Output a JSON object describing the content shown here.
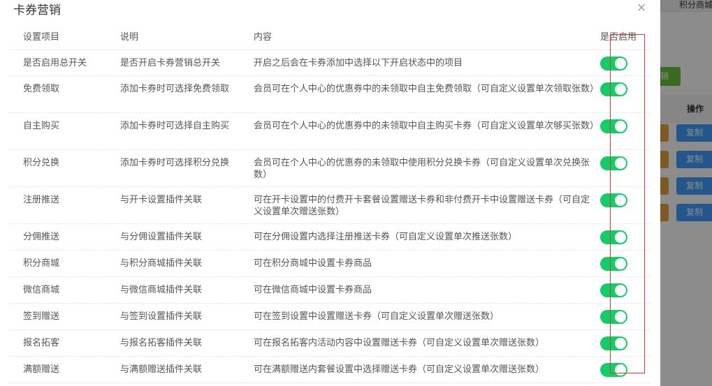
{
  "background": {
    "tab_label": "积分商城",
    "green_button_label": "销",
    "operations_header": "操作",
    "copy_label": "复制"
  },
  "dialog": {
    "title": "卡券营销",
    "close_icon": "close-icon"
  },
  "table": {
    "headers": [
      "设置项目",
      "说明",
      "内容",
      "是否启用"
    ],
    "rows": [
      {
        "item": "是否启用总开关",
        "desc": "是否开启卡券营销总开关",
        "content": "开启之后会在卡券添加中选择以下开启状态中的项目",
        "enabled": true
      },
      {
        "item": "免费领取",
        "desc": "添加卡券时可选择免费领取",
        "content": "会员可在个人中心的优惠券中的未领取中自主免费领取（可自定义设置单次领取张数）",
        "enabled": true
      },
      {
        "item": "自主购买",
        "desc": "添加卡券时可选择自主购买",
        "content": "会员可在个人中心的优惠券中的未领取中自主购买卡券（可自定义设置单次够买张数）",
        "enabled": true
      },
      {
        "item": "积分兑换",
        "desc": "添加卡券时可选择积分兑换",
        "content": "会员可在个人中心的优惠券的未领取中使用积分兑换卡券（可自定义设置单次兑换张数）",
        "enabled": true
      },
      {
        "item": "注册推送",
        "desc": "与开卡设置插件关联",
        "content": "可在开卡设置中的付费开卡套餐设置赠送卡券和非付费开卡中设置赠送卡券（可自定义设置单次赠送张数）",
        "enabled": true
      },
      {
        "item": "分佣推送",
        "desc": "与分佣设置插件关联",
        "content": "可在分佣设置内选择注册推送卡券（可自定义设置单次推送张数）",
        "enabled": true
      },
      {
        "item": "积分商城",
        "desc": "与积分商城插件关联",
        "content": "可在积分商城中设置卡券商品",
        "enabled": true
      },
      {
        "item": "微信商城",
        "desc": "与微信商城插件关联",
        "content": "可在微信商城中设置卡券商品",
        "enabled": true
      },
      {
        "item": "签到赠送",
        "desc": "与签到设置插件关联",
        "content": "可在签到设置中设置赠送卡券（可自定义设置单次赠送张数）",
        "enabled": true
      },
      {
        "item": "报名拓客",
        "desc": "与报名拓客插件关联",
        "content": "可在报名拓客内活动内容中设置赠送卡券（可自定义设置单次赠送张数）",
        "enabled": true
      },
      {
        "item": "满额赠送",
        "desc": "与满额赠送插件关联",
        "content": "可在满额赠送内套餐设置中选择赠送卡券（可自定义设置单次赠送张数）",
        "enabled": true
      }
    ]
  },
  "colors": {
    "switch_on": "#13ce66",
    "highlight_box": "#e23535",
    "overlay": "#000000",
    "bg_green": "#67c23a",
    "bg_orange": "#e6a23c",
    "bg_blue": "#409eff"
  }
}
